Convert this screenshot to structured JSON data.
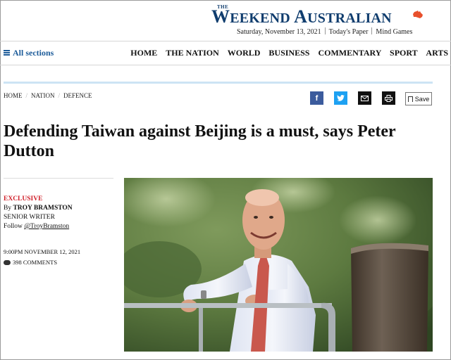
{
  "masthead": {
    "logo_the": "THE",
    "logo_name": "Weekend Australian",
    "date": "Saturday, November 13, 2021",
    "todays_paper": "Today's Paper",
    "mind_games": "Mind Games"
  },
  "nav": {
    "all_sections": "All sections",
    "links": [
      "HOME",
      "THE NATION",
      "WORLD",
      "BUSINESS",
      "COMMENTARY",
      "SPORT",
      "ARTS"
    ]
  },
  "breadcrumb": [
    "HOME",
    "NATION",
    "DEFENCE"
  ],
  "share": {
    "facebook": "f",
    "save_label": "Save"
  },
  "article": {
    "headline": "Defending Taiwan against Beijing is a must, says Peter Dutton",
    "kicker": "EXCLUSIVE",
    "by": "By",
    "author": "TROY BRAMSTON",
    "role": "SENIOR WRITER",
    "follow": "Follow",
    "handle": "@TroyBramston",
    "published": "9:00PM NOVEMBER 12, 2021",
    "comments": "398 COMMENTS"
  },
  "colors": {
    "brand_navy": "#103d6e",
    "link_blue": "#1d5c9a",
    "kicker_red": "#d0202a",
    "facebook": "#3b5b9d",
    "twitter": "#1da1f2",
    "accent_band": "#cde4f4"
  }
}
